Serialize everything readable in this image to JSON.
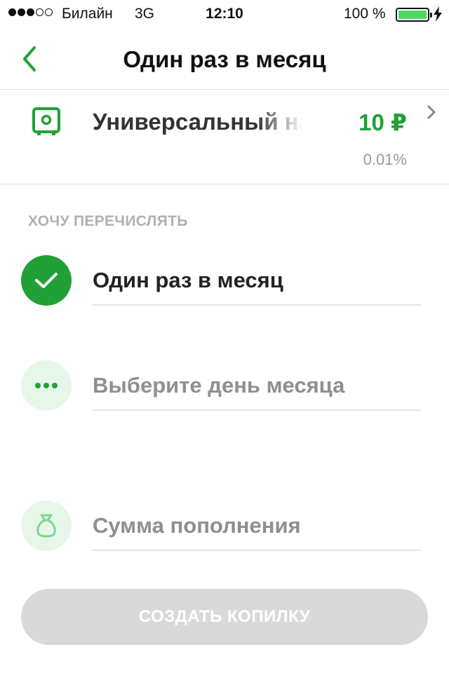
{
  "status_bar": {
    "carrier": "Билайн",
    "network": "3G",
    "time": "12:10",
    "battery": "100 %",
    "battery_level": 1.0,
    "signal_bars_filled": 3,
    "signal_bars_total": 5
  },
  "nav": {
    "title": "Один раз в месяц",
    "back_icon": "chevron-left-icon"
  },
  "account": {
    "icon": "safe-icon",
    "name": "Универсальный накопительный",
    "amount": "10 ₽",
    "rate": "0.01%"
  },
  "section": {
    "label": "ХОЧУ ПЕРЕЧИСЛЯТЬ"
  },
  "options": [
    {
      "label": "Один раз в месяц",
      "icon": "checkmark-icon",
      "state": "selected"
    },
    {
      "label": "Выберите день месяца",
      "icon": "ellipsis-icon",
      "state": "placeholder"
    },
    {
      "label": "Сумма пополнения",
      "icon": "money-bag-icon",
      "state": "placeholder"
    }
  ],
  "create_button": {
    "label": "СОЗДАТЬ КОПИЛКУ"
  },
  "colors": {
    "accent_green": "#21a038",
    "light_green": "#e6f7ea",
    "disabled_button": "#d9d9d9",
    "placeholder_text": "#8e8e93"
  }
}
